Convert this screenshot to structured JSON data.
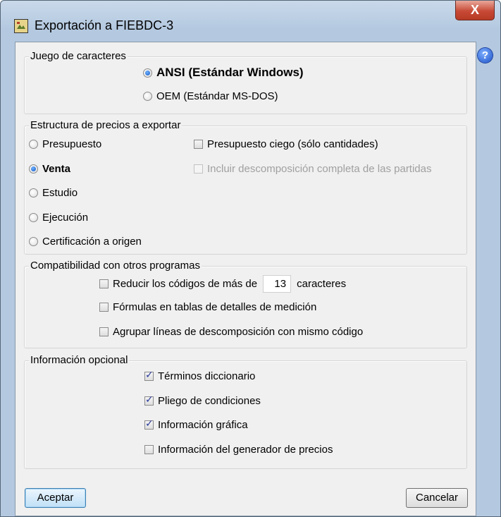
{
  "window": {
    "title": "Exportación a FIEBDC-3",
    "close_label": "X",
    "help_label": "?"
  },
  "charset_group": {
    "legend": "Juego de caracteres",
    "options": [
      {
        "label": "ANSI (Estándar Windows)",
        "selected": true
      },
      {
        "label": "OEM (Estándar MS-DOS)",
        "selected": false
      }
    ]
  },
  "price_group": {
    "legend": "Estructura de precios a exportar",
    "options": [
      {
        "label": "Presupuesto",
        "selected": false
      },
      {
        "label": "Venta",
        "selected": true
      },
      {
        "label": "Estudio",
        "selected": false
      },
      {
        "label": "Ejecución",
        "selected": false
      },
      {
        "label": "Certificación a origen",
        "selected": false
      }
    ],
    "blind_budget_label": "Presupuesto ciego (sólo cantidades)",
    "full_breakdown_label": "Incluir descomposición completa de las partidas"
  },
  "compat_group": {
    "legend": "Compatibilidad con otros programas",
    "reduce_codes_label": "Reducir los códigos de más de",
    "reduce_codes_value": "13",
    "reduce_codes_suffix": "caracteres",
    "formulas_label": "Fórmulas en tablas de detalles de medición",
    "group_lines_label": "Agrupar líneas de descomposición con mismo código"
  },
  "info_group": {
    "legend": "Información opcional",
    "items": [
      {
        "label": "Términos diccionario",
        "checked": true
      },
      {
        "label": "Pliego de condiciones",
        "checked": true
      },
      {
        "label": "Información gráfica",
        "checked": true
      },
      {
        "label": "Información del generador de precios",
        "checked": false
      }
    ]
  },
  "buttons": {
    "accept": "Aceptar",
    "cancel": "Cancelar"
  }
}
